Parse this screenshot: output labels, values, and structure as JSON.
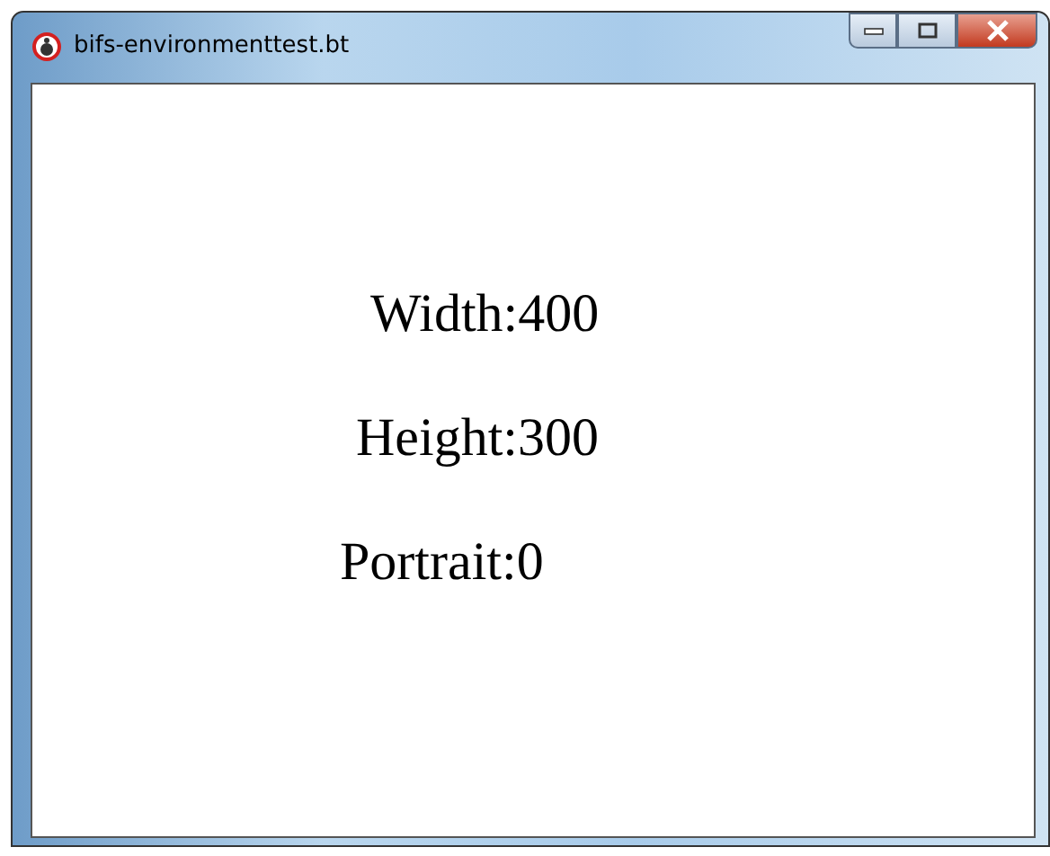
{
  "window": {
    "title": "bifs-environmenttest.bt"
  },
  "lines": [
    "Width:400",
    "Height:300",
    "Portrait:0"
  ]
}
